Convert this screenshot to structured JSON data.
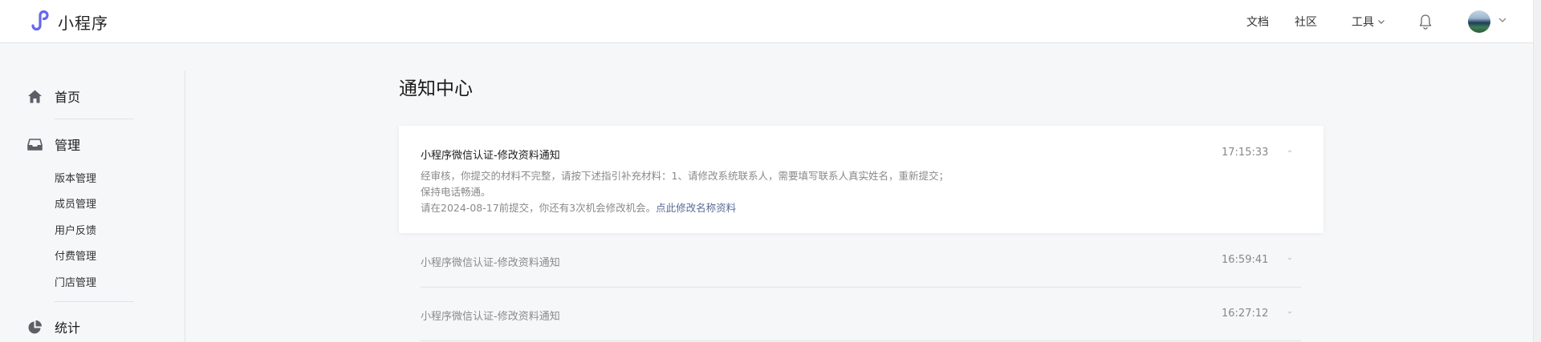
{
  "header": {
    "app_name": "小程序",
    "nav": {
      "docs": "文档",
      "community": "社区",
      "tools": "工具"
    },
    "icons": {
      "logo": "miniprogram-logo-icon",
      "bell": "bell-icon",
      "chevron": "chevron-down-icon"
    },
    "accent_color": "#6467f0"
  },
  "sidebar": {
    "home": "首页",
    "manage": "管理",
    "sub_items": [
      "版本管理",
      "成员管理",
      "用户反馈",
      "付费管理",
      "门店管理"
    ],
    "stats": "统计"
  },
  "main": {
    "title": "通知中心",
    "notices": [
      {
        "title": "小程序微信认证-修改资料通知",
        "time": "17:15:33",
        "expanded": true,
        "body_line1": "经审核，你提交的材料不完整，请按下述指引补充材料：1、请修改系统联系人，需要填写联系人真实姓名，重新提交；",
        "body_line2": "保持电话畅通。",
        "body_line3": "请在2024-08-17前提交，你还有3次机会修改机会。",
        "link": "点此修改名称资料"
      },
      {
        "title": "小程序微信认证-修改资料通知",
        "time": "16:59:41",
        "expanded": false
      },
      {
        "title": "小程序微信认证-修改资料通知",
        "time": "16:27:12",
        "expanded": false
      }
    ]
  }
}
